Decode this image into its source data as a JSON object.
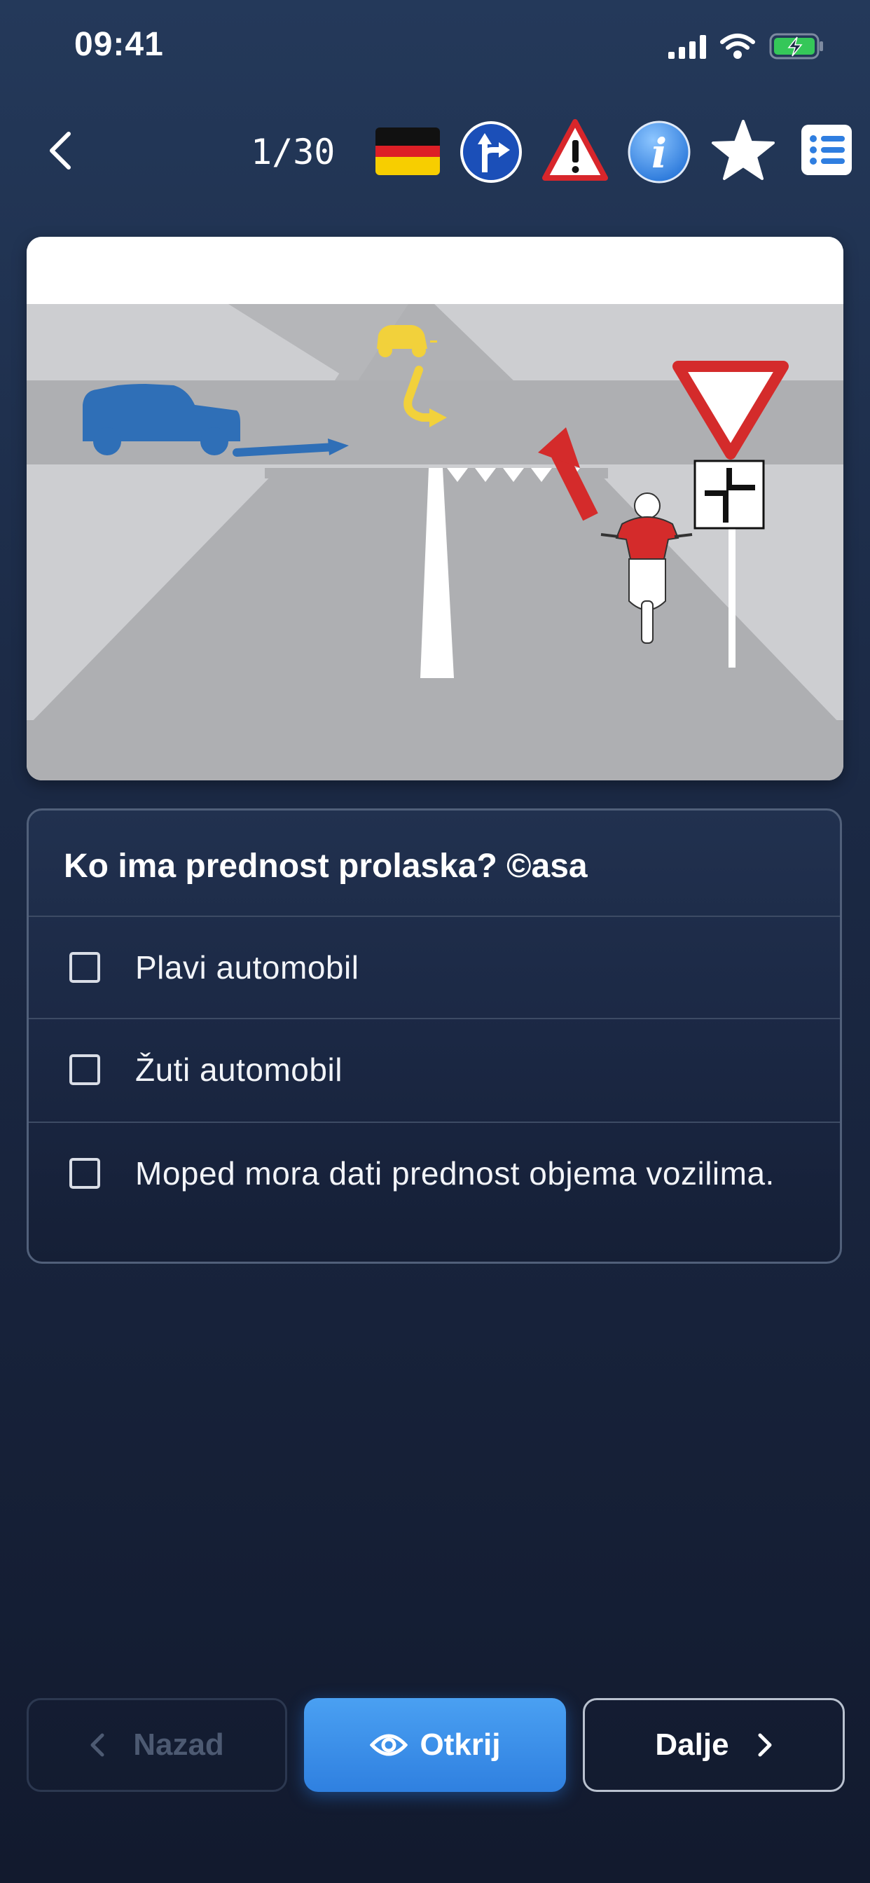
{
  "status_bar": {
    "time": "09:41"
  },
  "toolbar": {
    "counter": "1/30"
  },
  "question": {
    "title": "Ko ima prednost prolaska? ©asa",
    "answers": [
      {
        "text": "Plavi automobil",
        "checked": false
      },
      {
        "text": "Žuti automobil",
        "checked": false
      },
      {
        "text": "Moped mora dati prednost objema vozilima.",
        "checked": false
      }
    ]
  },
  "buttons": {
    "back_label": "Nazad",
    "reveal_label": "Otkrij",
    "next_label": "Dalje"
  },
  "colors": {
    "primary_button": "#3a8ee8",
    "blue_car": "#2f6fb7",
    "yellow_car": "#f2d13b",
    "red_arrow": "#d42b2b"
  },
  "icons": [
    "back-chevron-icon",
    "german-flag-icon",
    "direction-sign-icon",
    "warning-sign-icon",
    "info-icon",
    "star-icon",
    "list-icon",
    "eye-icon"
  ]
}
